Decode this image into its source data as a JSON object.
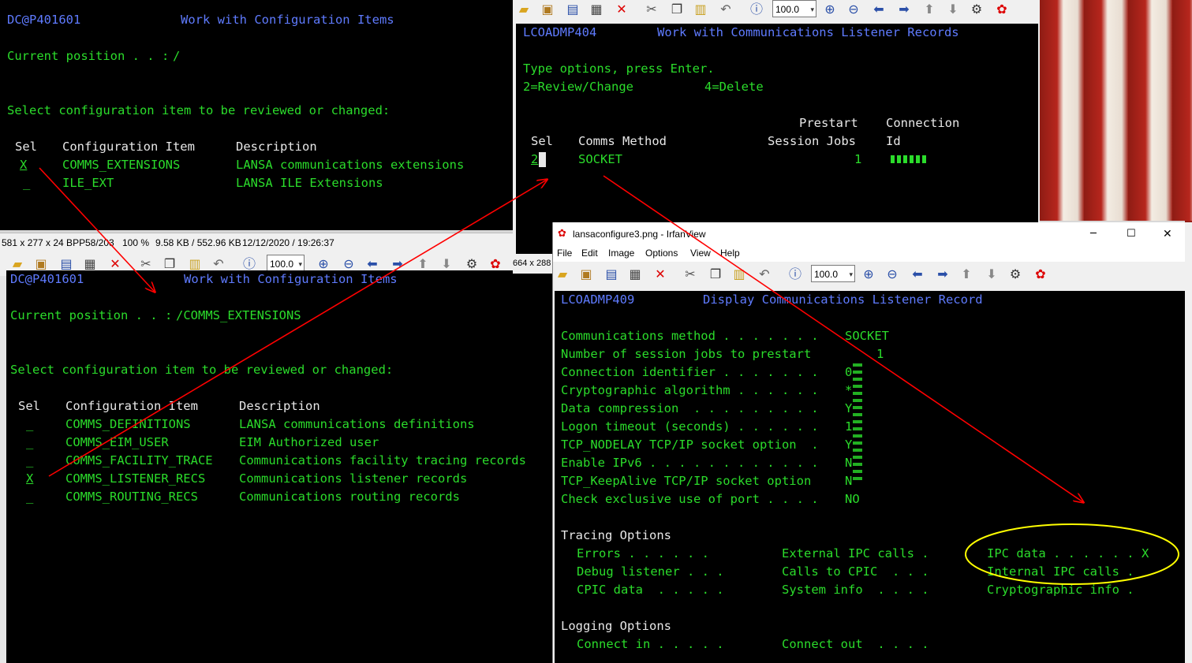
{
  "screen1": {
    "program_id": "DC@P401601",
    "title": "Work with Configuration Items",
    "position_label": "Current position . . :",
    "position_value": "/",
    "instruction": "Select configuration item to be reviewed or changed:",
    "headers": {
      "sel": "Sel",
      "item": "Configuration Item",
      "desc": "Description"
    },
    "rows": [
      {
        "sel": "X",
        "item": "COMMS_EXTENSIONS",
        "desc": "LANSA communications extensions"
      },
      {
        "sel": "_",
        "item": "ILE_EXT",
        "desc": "LANSA ILE Extensions"
      }
    ],
    "status": {
      "dimensions": "581 x 277 x 24 BPP",
      "index": "58/203",
      "zoom": "100 %",
      "size": "9.58 KB / 552.96 KB",
      "datetime": "12/12/2020 / 19:26:37"
    }
  },
  "screen2": {
    "program_id": "DC@P401601",
    "title": "Work with Configuration Items",
    "position_label": "Current position . . :",
    "position_value": "/COMMS_EXTENSIONS",
    "instruction": "Select configuration item to be reviewed or changed:",
    "headers": {
      "sel": "Sel",
      "item": "Configuration Item",
      "desc": "Description"
    },
    "rows": [
      {
        "sel": "_",
        "item": "COMMS_DEFINITIONS",
        "desc": "LANSA communications definitions"
      },
      {
        "sel": "_",
        "item": "COMMS_EIM_USER",
        "desc": "EIM Authorized user"
      },
      {
        "sel": "_",
        "item": "COMMS_FACILITY_TRACE",
        "desc": "Communications facility tracing records"
      },
      {
        "sel": "X",
        "item": "COMMS_LISTENER_RECS",
        "desc": "Communications listener records"
      },
      {
        "sel": "_",
        "item": "COMMS_ROUTING_RECS",
        "desc": "Communications routing records"
      }
    ],
    "toolbar_zoom": "100.0"
  },
  "screen3": {
    "program_id": "LCOADMP404",
    "title": "Work with Communications Listener Records",
    "instruction": "Type options, press Enter.",
    "opt_change": "2=Review/Change",
    "opt_delete": "4=Delete",
    "headers": {
      "sel": "Sel",
      "method": "Comms Method",
      "prestart_top": "Prestart",
      "prestart_bottom": "Session Jobs",
      "conn_top": "Connection",
      "conn_bottom": "Id"
    },
    "row": {
      "sel": "2",
      "method": "SOCKET",
      "jobs": "1"
    },
    "toolbar_zoom": "100.0",
    "side_status": "664 x 288"
  },
  "window4": {
    "title": "lansaconfigure3.png - IrfanView",
    "menu": [
      "File",
      "Edit",
      "Image",
      "Options",
      "View",
      "Help"
    ],
    "toolbar_zoom": "100.0",
    "program_id": "LCOADMP409",
    "title_screen": "Display Communications Listener Record",
    "fields": [
      {
        "label": "Communications method . . . . . . .",
        "value": "SOCKET"
      },
      {
        "label": "Number of session jobs to prestart",
        "value": "1"
      },
      {
        "label": "Connection identifier . . . . . . .",
        "value": "0"
      },
      {
        "label": "Cryptographic algorithm . . . . . .",
        "value": "*"
      },
      {
        "label": "Data compression  . . . . . . . . .",
        "value": "Y"
      },
      {
        "label": "Logon timeout (seconds) . . . . . .",
        "value": "1"
      },
      {
        "label": "TCP_NODELAY TCP/IP socket option  .",
        "value": "Y"
      },
      {
        "label": "Enable IPv6 . . . . . . . . . . . .",
        "value": "N"
      },
      {
        "label": "TCP_KeepAlive TCP/IP socket option",
        "value": "N"
      },
      {
        "label": "Check exclusive use of port . . . .",
        "value": "NO"
      }
    ],
    "tracing_title": "Tracing Options",
    "tracing": [
      [
        "Errors . . . . . .",
        "External IPC calls .",
        "IPC data . . . . . . X"
      ],
      [
        "Debug listener . . .",
        "Calls to CPIC  . . .",
        "Internal IPC calls ."
      ],
      [
        "CPIC data  . . . . .",
        "System info  . . . .",
        "Cryptographic info ."
      ]
    ],
    "logging_title": "Logging Options",
    "logging": [
      "Connect in . . . . .",
      "Connect out  . . . ."
    ]
  },
  "colors": {
    "terminal_bg": "#000000",
    "terminal_green": "#2bdc2b",
    "terminal_blue": "#5f7bff",
    "arrow_red": "#ff0000",
    "highlight_yellow": "#ffff00"
  }
}
